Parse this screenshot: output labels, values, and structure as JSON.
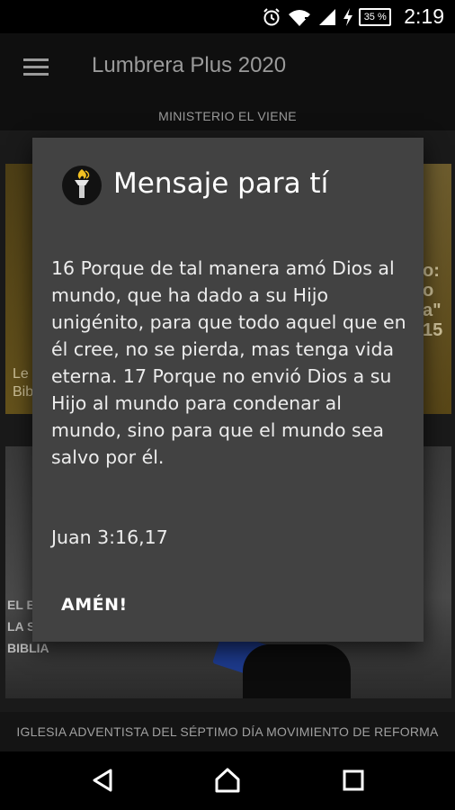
{
  "status_bar": {
    "time": "2:19",
    "battery_percent": "35 %",
    "icons": [
      "alarm-icon",
      "wifi-icon",
      "signal-icon",
      "charging-icon",
      "battery-icon"
    ]
  },
  "app_bar": {
    "title": "Lumbrera Plus 2020",
    "menu_icon": "hamburger-menu-icon"
  },
  "sub_header": {
    "text": "MINISTERIO EL VIENE"
  },
  "background_cards": {
    "top_left_text": "Le\nBib",
    "top_right_text": "o:\no\na\"\n15",
    "bottom_text": "EL BA\nLA S\nBIBLIA"
  },
  "dialog": {
    "title": "Mensaje para tí",
    "icon": "torch-logo-icon",
    "message": "16 Porque de tal manera amó Dios al mundo, que ha dado a su Hijo unigénito, para que todo aquel que en él cree, no se pierda, mas tenga vida eterna. 17 Porque no envió Dios a su Hijo al mundo para condenar al mundo, sino para que el mundo sea salvo por él.",
    "reference": "Juan 3:16,17",
    "button_label": "AMÉN!"
  },
  "footer": {
    "text": "IGLESIA ADVENTISTA DEL SÉPTIMO DÍA MOVIMIENTO DE REFORMA"
  },
  "nav_bar": {
    "icons": [
      "back-icon",
      "home-icon",
      "recents-icon"
    ]
  },
  "colors": {
    "dialog_bg": "#424242",
    "app_bar_bg": "#0f0f0f",
    "text_muted": "#9a9a9a"
  }
}
